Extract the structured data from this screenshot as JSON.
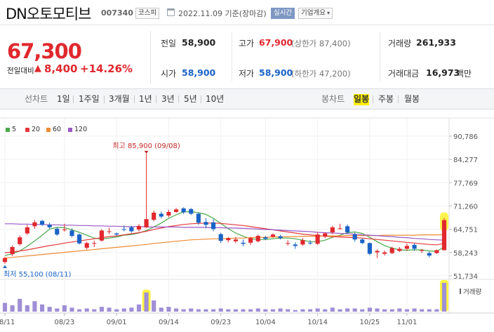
{
  "header": {
    "stock_name": "DN오토모티브",
    "stock_code": "007340",
    "market": "코스피",
    "date_text": "2022.11.09  기준(장마감)",
    "realtime": "실시간",
    "company_info": "기업개요",
    "company_info_chevron": "▾"
  },
  "price": {
    "current": "67,300",
    "change_label": "전일대비",
    "change_arrow": "▲",
    "change_value": "8,400",
    "change_pct": "+14.26%"
  },
  "stats": {
    "prev_close_label": "전일",
    "prev_close": "58,900",
    "high_label": "고가",
    "high": "67,900",
    "upper_limit": "(상한가 87,400)",
    "volume_label": "거래량",
    "volume": "261,933",
    "open_label": "시가",
    "open": "58,900",
    "low_label": "저가",
    "low": "58,900",
    "lower_limit": "(하한가 47,200)",
    "amount_label": "거래대금",
    "amount": "16,973",
    "amount_unit": "백만"
  },
  "tabs": {
    "line_chart": "선차트",
    "periods": [
      "1일",
      "1주일",
      "3개월",
      "1년",
      "3년",
      "5년",
      "10년"
    ],
    "candle_chart": "봉차트",
    "candle_periods": [
      "일봉",
      "주봉",
      "월봉"
    ],
    "active_candle_period": "일봉"
  },
  "legend": [
    {
      "label": "5",
      "color": "#49a84a"
    },
    {
      "label": "20",
      "color": "#e4393c"
    },
    {
      "label": "60",
      "color": "#ef8b32"
    },
    {
      "label": "120",
      "color": "#9b59c6"
    }
  ],
  "colors": {
    "up": "#e0282e",
    "down": "#1a63c6",
    "volume": "#9f8fd6",
    "highlight": "#fdf001"
  },
  "chart_data": {
    "type": "candlestick",
    "y_ticks": [
      "90,786",
      "84,277",
      "77,769",
      "71,260",
      "64,751",
      "58,243",
      "51,734"
    ],
    "ylim": [
      51734,
      90786
    ],
    "x_ticks": [
      {
        "label": "08/11",
        "index": 0
      },
      {
        "label": "08/23",
        "index": 8
      },
      {
        "label": "09/01",
        "index": 15
      },
      {
        "label": "09/14",
        "index": 22
      },
      {
        "label": "09/23",
        "index": 29
      },
      {
        "label": "10/04",
        "index": 35
      },
      {
        "label": "10/14",
        "index": 42
      },
      {
        "label": "10/25",
        "index": 49
      },
      {
        "label": "11/01",
        "index": 54
      }
    ],
    "max_annotation": {
      "text": "최고 85,900 (09/08)",
      "value": 85900,
      "index": 19
    },
    "min_annotation": {
      "text": "최저 55,100 (08/11)",
      "value": 55100,
      "index": 0
    },
    "volume_label": "거래량",
    "candles": [
      {
        "o": 55600,
        "h": 57000,
        "l": 55100,
        "c": 56700
      },
      {
        "o": 57800,
        "h": 60200,
        "l": 57300,
        "c": 59800
      },
      {
        "o": 60600,
        "h": 63000,
        "l": 60200,
        "c": 62500
      },
      {
        "o": 63600,
        "h": 66000,
        "l": 63200,
        "c": 65300
      },
      {
        "o": 65600,
        "h": 67300,
        "l": 64900,
        "c": 66700
      },
      {
        "o": 67100,
        "h": 67400,
        "l": 65700,
        "c": 66000
      },
      {
        "o": 66000,
        "h": 66600,
        "l": 64900,
        "c": 65300
      },
      {
        "o": 64900,
        "h": 65300,
        "l": 62900,
        "c": 63300
      },
      {
        "o": 64500,
        "h": 66300,
        "l": 64100,
        "c": 64700
      },
      {
        "o": 64400,
        "h": 65000,
        "l": 62500,
        "c": 62900
      },
      {
        "o": 63300,
        "h": 63600,
        "l": 60500,
        "c": 60800
      },
      {
        "o": 59600,
        "h": 61300,
        "l": 59100,
        "c": 60900
      },
      {
        "o": 60800,
        "h": 61600,
        "l": 59800,
        "c": 60900
      },
      {
        "o": 61600,
        "h": 64800,
        "l": 61300,
        "c": 64400
      },
      {
        "o": 64200,
        "h": 65200,
        "l": 63400,
        "c": 64200
      },
      {
        "o": 63600,
        "h": 63800,
        "l": 62900,
        "c": 63300
      },
      {
        "o": 64800,
        "h": 65800,
        "l": 64200,
        "c": 64700
      },
      {
        "o": 65300,
        "h": 65700,
        "l": 63800,
        "c": 64200
      },
      {
        "o": 64700,
        "h": 66200,
        "l": 64100,
        "c": 65700
      },
      {
        "o": 65300,
        "h": 85900,
        "l": 65100,
        "c": 67600
      },
      {
        "o": 67400,
        "h": 70000,
        "l": 67000,
        "c": 69400
      },
      {
        "o": 69100,
        "h": 69700,
        "l": 67800,
        "c": 68300
      },
      {
        "o": 68600,
        "h": 70200,
        "l": 68100,
        "c": 69600
      },
      {
        "o": 69600,
        "h": 70700,
        "l": 69300,
        "c": 70300
      },
      {
        "o": 70600,
        "h": 70900,
        "l": 69000,
        "c": 69500
      },
      {
        "o": 70400,
        "h": 70700,
        "l": 68700,
        "c": 69100
      },
      {
        "o": 69100,
        "h": 69400,
        "l": 66000,
        "c": 66600
      },
      {
        "o": 66800,
        "h": 67900,
        "l": 65000,
        "c": 66000
      },
      {
        "o": 66700,
        "h": 67600,
        "l": 64200,
        "c": 64800
      },
      {
        "o": 63400,
        "h": 63800,
        "l": 60900,
        "c": 61500
      },
      {
        "o": 61700,
        "h": 62600,
        "l": 61100,
        "c": 62300
      },
      {
        "o": 61400,
        "h": 62600,
        "l": 60900,
        "c": 61900
      },
      {
        "o": 61000,
        "h": 61900,
        "l": 60000,
        "c": 60700
      },
      {
        "o": 61000,
        "h": 62700,
        "l": 60400,
        "c": 62300
      },
      {
        "o": 61400,
        "h": 63300,
        "l": 61100,
        "c": 62900
      },
      {
        "o": 62500,
        "h": 62900,
        "l": 61700,
        "c": 62100
      },
      {
        "o": 62700,
        "h": 63600,
        "l": 62400,
        "c": 63300
      },
      {
        "o": 62800,
        "h": 63200,
        "l": 61900,
        "c": 62300
      },
      {
        "o": 60900,
        "h": 61700,
        "l": 60200,
        "c": 60900
      },
      {
        "o": 60500,
        "h": 61100,
        "l": 59300,
        "c": 60100
      },
      {
        "o": 60500,
        "h": 62300,
        "l": 60100,
        "c": 61700
      },
      {
        "o": 61000,
        "h": 61700,
        "l": 60400,
        "c": 60900
      },
      {
        "o": 60700,
        "h": 64000,
        "l": 60400,
        "c": 63300
      },
      {
        "o": 62700,
        "h": 63900,
        "l": 62300,
        "c": 63600
      },
      {
        "o": 63900,
        "h": 65700,
        "l": 63400,
        "c": 65300
      },
      {
        "o": 65000,
        "h": 66300,
        "l": 64700,
        "c": 65000
      },
      {
        "o": 65600,
        "h": 66100,
        "l": 63600,
        "c": 63900
      },
      {
        "o": 63300,
        "h": 63800,
        "l": 61300,
        "c": 61900
      },
      {
        "o": 61900,
        "h": 62200,
        "l": 60600,
        "c": 60900
      },
      {
        "o": 60900,
        "h": 61100,
        "l": 57500,
        "c": 57900
      },
      {
        "o": 58300,
        "h": 59100,
        "l": 56700,
        "c": 58700
      },
      {
        "o": 57900,
        "h": 58800,
        "l": 57400,
        "c": 58300
      },
      {
        "o": 58100,
        "h": 59900,
        "l": 57800,
        "c": 59500
      },
      {
        "o": 58700,
        "h": 59800,
        "l": 58400,
        "c": 59300
      },
      {
        "o": 59300,
        "h": 60800,
        "l": 58700,
        "c": 60100
      },
      {
        "o": 60400,
        "h": 60800,
        "l": 58700,
        "c": 59300
      },
      {
        "o": 58900,
        "h": 59300,
        "l": 58100,
        "c": 58900
      },
      {
        "o": 58100,
        "h": 58500,
        "l": 56900,
        "c": 57400
      },
      {
        "o": 58100,
        "h": 59100,
        "l": 57900,
        "c": 58900
      },
      {
        "o": 58900,
        "h": 67900,
        "l": 58900,
        "c": 67300
      }
    ],
    "volumes": [
      1.1,
      0.8,
      1.6,
      0.8,
      1.3,
      0.9,
      0.6,
      0.4,
      0.8,
      0.5,
      0.3,
      0.4,
      0.3,
      0.6,
      0.5,
      0.3,
      0.4,
      0.5,
      0.9,
      2.4,
      1.4,
      0.5,
      0.6,
      0.4,
      0.3,
      0.4,
      0.3,
      0.3,
      0.3,
      0.4,
      0.3,
      0.3,
      0.3,
      0.3,
      0.4,
      0.3,
      0.3,
      0.4,
      0.3,
      0.2,
      0.3,
      0.3,
      0.4,
      0.3,
      0.5,
      0.3,
      0.4,
      0.4,
      0.3,
      0.5,
      0.4,
      0.3,
      0.3,
      0.4,
      0.3,
      0.4,
      0.3,
      0.3,
      0.3,
      3.6
    ],
    "moving_averages": [
      {
        "period": "5",
        "color": "#49a84a",
        "values": [
          57400,
          57900,
          58700,
          60000,
          61500,
          63100,
          64800,
          65300,
          65200,
          64600,
          63900,
          63100,
          62300,
          62000,
          62300,
          62600,
          63100,
          63300,
          63700,
          64400,
          65400,
          66500,
          67800,
          68800,
          69600,
          69700,
          69400,
          68900,
          67800,
          66400,
          64900,
          63700,
          62800,
          62100,
          61900,
          61900,
          62100,
          62300,
          62300,
          62100,
          61700,
          61300,
          61300,
          61700,
          62500,
          63100,
          63800,
          64000,
          63600,
          62500,
          61300,
          60200,
          59500,
          59000,
          58900,
          59000,
          59000,
          58700,
          58600,
          59800
        ]
      },
      {
        "period": "20",
        "color": "#e4393c",
        "values": [
          58200,
          58400,
          58700,
          59000,
          59400,
          59800,
          60200,
          60500,
          60900,
          61200,
          61500,
          61800,
          62100,
          62400,
          62700,
          62900,
          63200,
          63500,
          63800,
          64200,
          64700,
          65100,
          65500,
          65800,
          66100,
          66300,
          66400,
          66500,
          66500,
          66400,
          66200,
          66000,
          65800,
          65500,
          65200,
          64900,
          64600,
          64300,
          64000,
          63700,
          63400,
          63200,
          63000,
          62800,
          62700,
          62600,
          62500,
          62400,
          62300,
          62100,
          61900,
          61700,
          61500,
          61300,
          61100,
          60900,
          60700,
          60500,
          60400,
          60800
        ]
      },
      {
        "period": "60",
        "color": "#ef8b32",
        "values": [
          56700,
          56900,
          57100,
          57300,
          57500,
          57700,
          57900,
          58100,
          58300,
          58500,
          58700,
          58900,
          59100,
          59300,
          59500,
          59700,
          59900,
          60100,
          60300,
          60500,
          60800,
          61000,
          61200,
          61400,
          61600,
          61800,
          61900,
          62000,
          62100,
          62100,
          62200,
          62300,
          62300,
          62400,
          62500,
          62500,
          62600,
          62600,
          62700,
          62700,
          62800,
          62800,
          62800,
          62900,
          62900,
          62900,
          63000,
          63000,
          63000,
          63000,
          63000,
          63100,
          63100,
          63100,
          63100,
          63100,
          63200,
          63200,
          63200,
          63300
        ]
      },
      {
        "period": "120",
        "color": "#9b59c6",
        "values": [
          66300,
          66300,
          66200,
          66200,
          66100,
          66100,
          66000,
          66000,
          65900,
          65900,
          65800,
          65800,
          65700,
          65700,
          65600,
          65600,
          65500,
          65500,
          65500,
          65400,
          65400,
          65400,
          65400,
          65400,
          65300,
          65300,
          65300,
          65300,
          65200,
          65200,
          65100,
          65100,
          65000,
          64900,
          64800,
          64700,
          64600,
          64500,
          64400,
          64300,
          64200,
          64100,
          63900,
          63800,
          63700,
          63600,
          63500,
          63400,
          63200,
          63100,
          63000,
          62800,
          62700,
          62500,
          62400,
          62200,
          62100,
          61900,
          61800,
          61700
        ]
      }
    ]
  }
}
